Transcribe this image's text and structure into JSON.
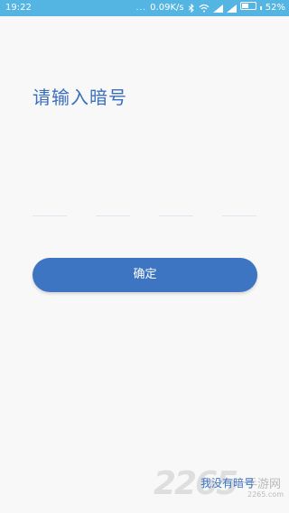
{
  "status_bar": {
    "time": "19:22",
    "dots": "...",
    "network_speed": "0.09K/s",
    "battery_percent": "52%",
    "battery_level": 0.52,
    "background": "#54b4e2"
  },
  "page": {
    "title": "请输入暗号",
    "code_boxes": [
      "",
      "",
      "",
      ""
    ]
  },
  "actions": {
    "confirm_label": "确定",
    "no_code_label": "我没有暗号"
  },
  "watermark": {
    "number": "2265",
    "site": "手游网",
    "url": "2265.com"
  },
  "colors": {
    "accent": "#3d75c2",
    "title": "#3a6fbd",
    "background": "#f8f8f8"
  }
}
